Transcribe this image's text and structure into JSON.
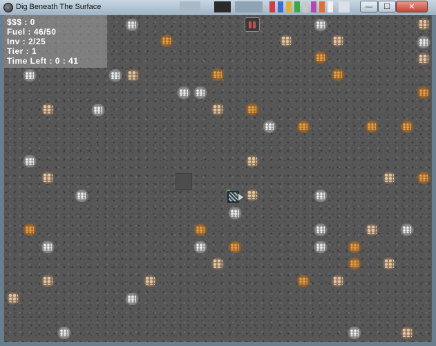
{
  "window": {
    "title": "Dig Beneath The Surface",
    "icon": "app-gear-icon",
    "controls": {
      "minimize_glyph": "—",
      "maximize_glyph": "☐",
      "close_glyph": "✕"
    }
  },
  "hud": {
    "money": "$$$ : 0",
    "fuel": "Fuel : 46/50",
    "inventory": "Inv : 2/25",
    "tier": "Tier : 1",
    "time_left": "Time Left : 0 : 41"
  },
  "pause": {
    "icon": "pause-icon",
    "color": "#c45050"
  },
  "colors": {
    "ground": "#575757",
    "hud_panel": "#a0a0a0",
    "hud_text": "#ffffff"
  },
  "ore_types": [
    "silver",
    "gold",
    "bronze"
  ]
}
